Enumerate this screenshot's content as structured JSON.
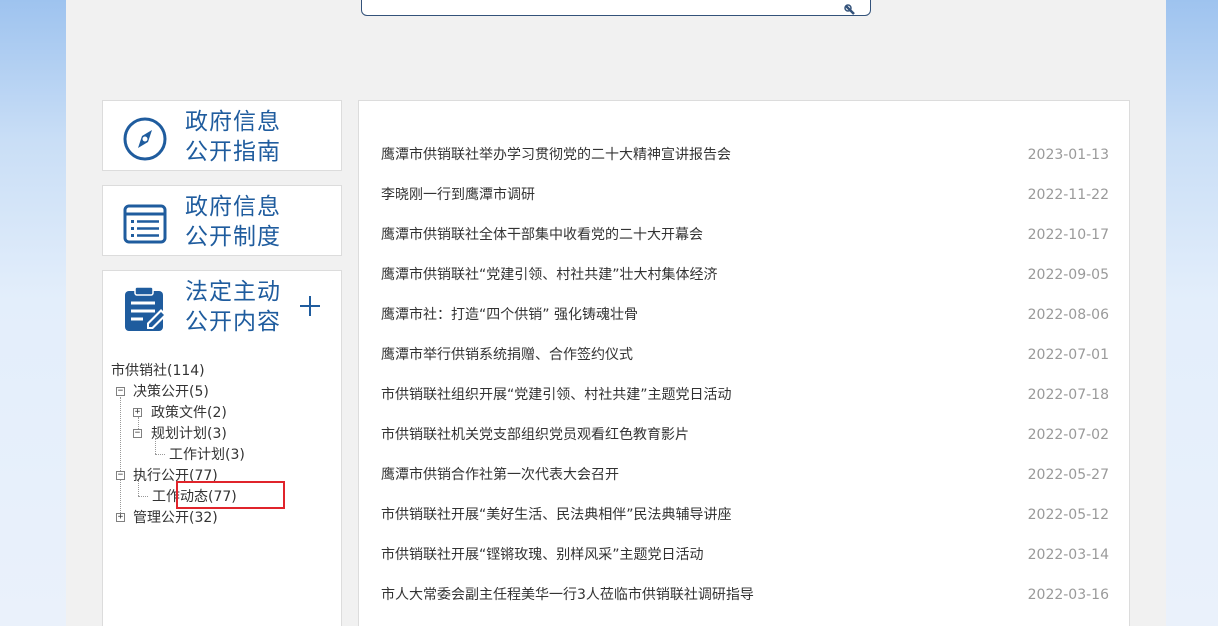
{
  "cards": [
    {
      "line1": "政府信息",
      "line2": "公开指南",
      "icon": "compass-icon"
    },
    {
      "line1": "政府信息",
      "line2": "公开制度",
      "icon": "document-list-icon"
    },
    {
      "line1": "法定主动",
      "line2": "公开内容",
      "icon": "clipboard-edit-icon",
      "toggle": "plus-icon"
    }
  ],
  "tree": {
    "root": "市供销社(114)",
    "decision": "决策公开(5)",
    "policy": "政策文件(2)",
    "plan": "规划计划(3)",
    "work_plan": "工作计划(3)",
    "execution": "执行公开(77)",
    "work_news": "工作动态(77)",
    "management": "管理公开(32)",
    "selected": "工作动态(77)",
    "highlight_color": "#e0242b"
  },
  "articles": [
    {
      "title": "鹰潭市供销联社举办学习贯彻党的二十大精神宣讲报告会",
      "date": "2023-01-13"
    },
    {
      "title": "李晓刚一行到鹰潭市调研",
      "date": "2022-11-22"
    },
    {
      "title": "鹰潭市供销联社全体干部集中收看党的二十大开幕会",
      "date": "2022-10-17"
    },
    {
      "title": "鹰潭市供销联社“党建引领、村社共建”壮大村集体经济",
      "date": "2022-09-05"
    },
    {
      "title": "鹰潭市社：打造“四个供销” 强化铸魂壮骨",
      "date": "2022-08-06"
    },
    {
      "title": "鹰潭市举行供销系统捐赠、合作签约仪式",
      "date": "2022-07-01"
    },
    {
      "title": "市供销联社组织开展“党建引领、村社共建”主题党日活动",
      "date": "2022-07-18"
    },
    {
      "title": "市供销联社机关党支部组织党员观看红色教育影片",
      "date": "2022-07-02"
    },
    {
      "title": "鹰潭市供销合作社第一次代表大会召开",
      "date": "2022-05-27"
    },
    {
      "title": "市供销联社开展“美好生活、民法典相伴”民法典辅导讲座",
      "date": "2022-05-12"
    },
    {
      "title": "市供销联社开展“铿锵玫瑰、别样风采”主题党日活动",
      "date": "2022-03-14"
    },
    {
      "title": "市人大常委会副主任程美华一行3人莅临市供销联社调研指导",
      "date": "2022-03-16"
    }
  ],
  "colors": {
    "accent": "#1f5c9e",
    "date": "#9a9a9a",
    "border": "#dcdcdc"
  }
}
